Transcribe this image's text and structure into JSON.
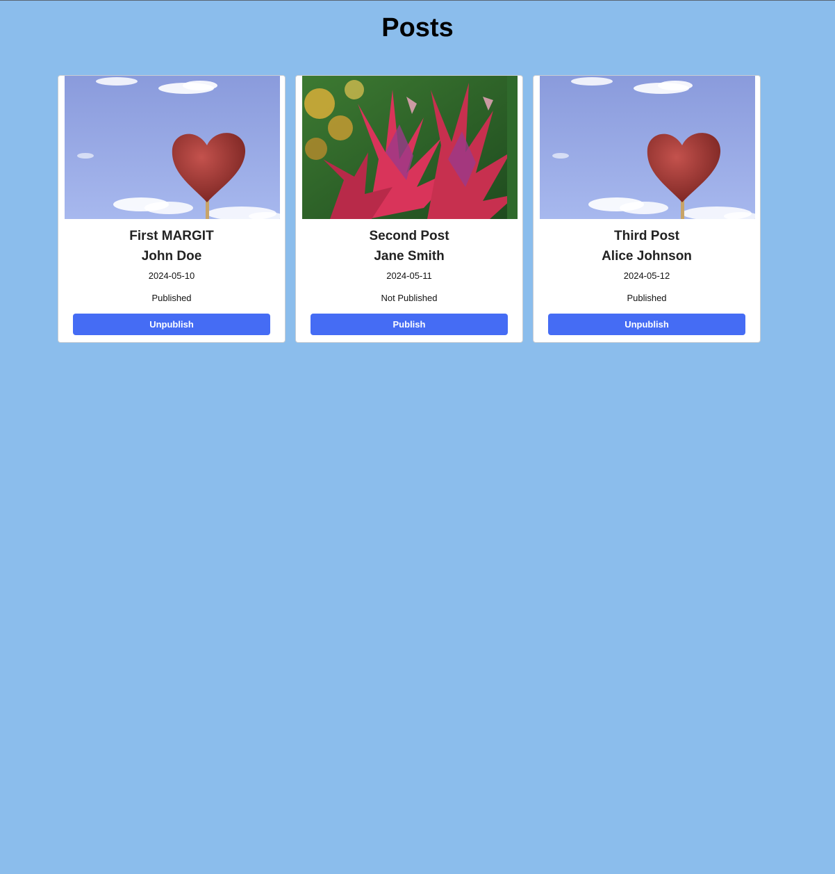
{
  "page": {
    "title": "Posts",
    "background_color": "#8bbdec"
  },
  "button_color": "#456cf4",
  "posts": [
    {
      "title": "First MARGIT",
      "author": "John Doe",
      "date": "2024-05-10",
      "status": "Published",
      "action_label": "Unpublish",
      "image": "heart-image"
    },
    {
      "title": "Second Post",
      "author": "Jane Smith",
      "date": "2024-05-11",
      "status": "Not Published",
      "action_label": "Publish",
      "image": "flower-image"
    },
    {
      "title": "Third Post",
      "author": "Alice Johnson",
      "date": "2024-05-12",
      "status": "Published",
      "action_label": "Unpublish",
      "image": "heart-image"
    }
  ]
}
